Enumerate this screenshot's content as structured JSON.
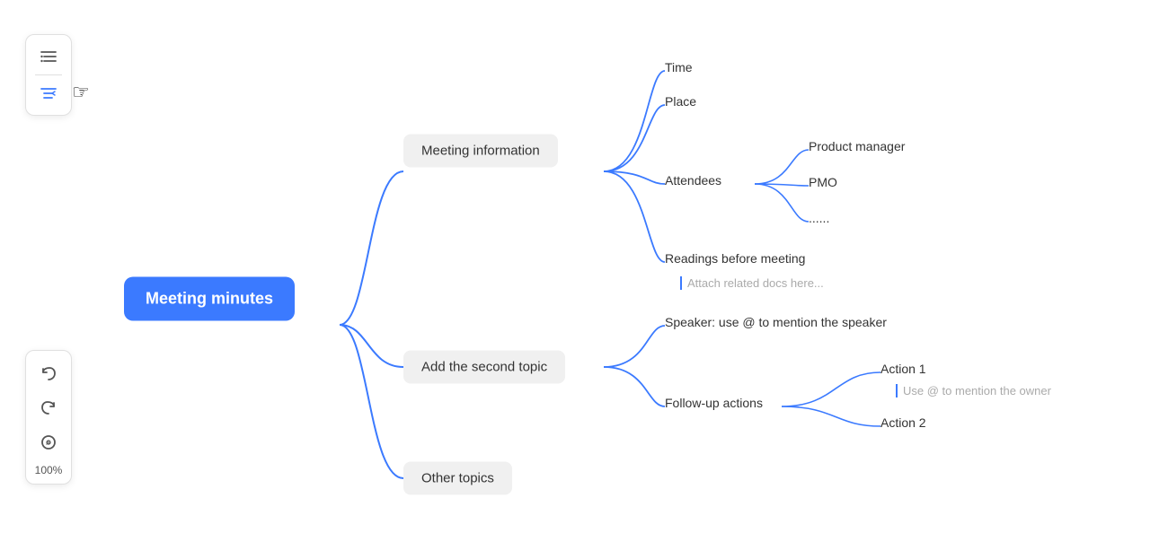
{
  "toolbar_top": {
    "btn1_icon": "≡",
    "btn2_icon": "⇤"
  },
  "toolbar_bottom": {
    "undo_icon": "↺",
    "redo_icon": "↻",
    "edit_icon": "✏",
    "zoom_label": "100%"
  },
  "mindmap": {
    "root_label": "Meeting minutes",
    "branch1_label": "Meeting information",
    "branch2_label": "Add the second topic",
    "branch3_label": "Other topics",
    "leaf_time": "Time",
    "leaf_place": "Place",
    "leaf_attendees": "Attendees",
    "leaf_product_manager": "Product manager",
    "leaf_pmo": "PMO",
    "leaf_dots": "......",
    "leaf_readings": "Readings before meeting",
    "leaf_attach": "Attach related docs here...",
    "leaf_speaker": "Speaker: use @ to mention the speaker",
    "leaf_followup": "Follow-up actions",
    "leaf_action1": "Action 1",
    "leaf_action1_hint": "Use @ to mention the owner",
    "leaf_action2": "Action 2"
  }
}
